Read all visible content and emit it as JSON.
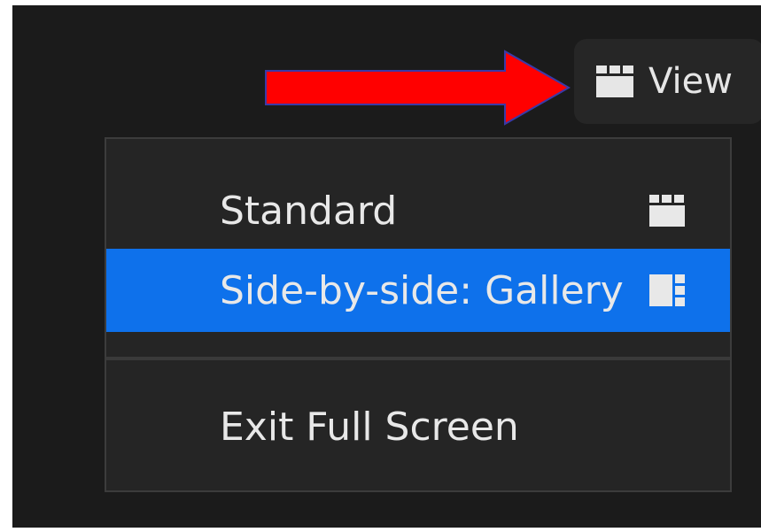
{
  "toolbar": {
    "view_label": "View",
    "view_icon": "grid-icon"
  },
  "menu": {
    "items": [
      {
        "label": "Standard",
        "icon": "grid-icon",
        "selected": false
      },
      {
        "label": "Side-by-side: Gallery",
        "icon": "side-by-side-gallery-icon",
        "selected": true
      },
      {
        "label": "Exit Full Screen"
      }
    ]
  },
  "colors": {
    "background": "#1b1b1b",
    "menu_background": "#252525",
    "highlight": "#0e71eb",
    "text": "#e8e8e8",
    "arrow": "#ff0000"
  }
}
